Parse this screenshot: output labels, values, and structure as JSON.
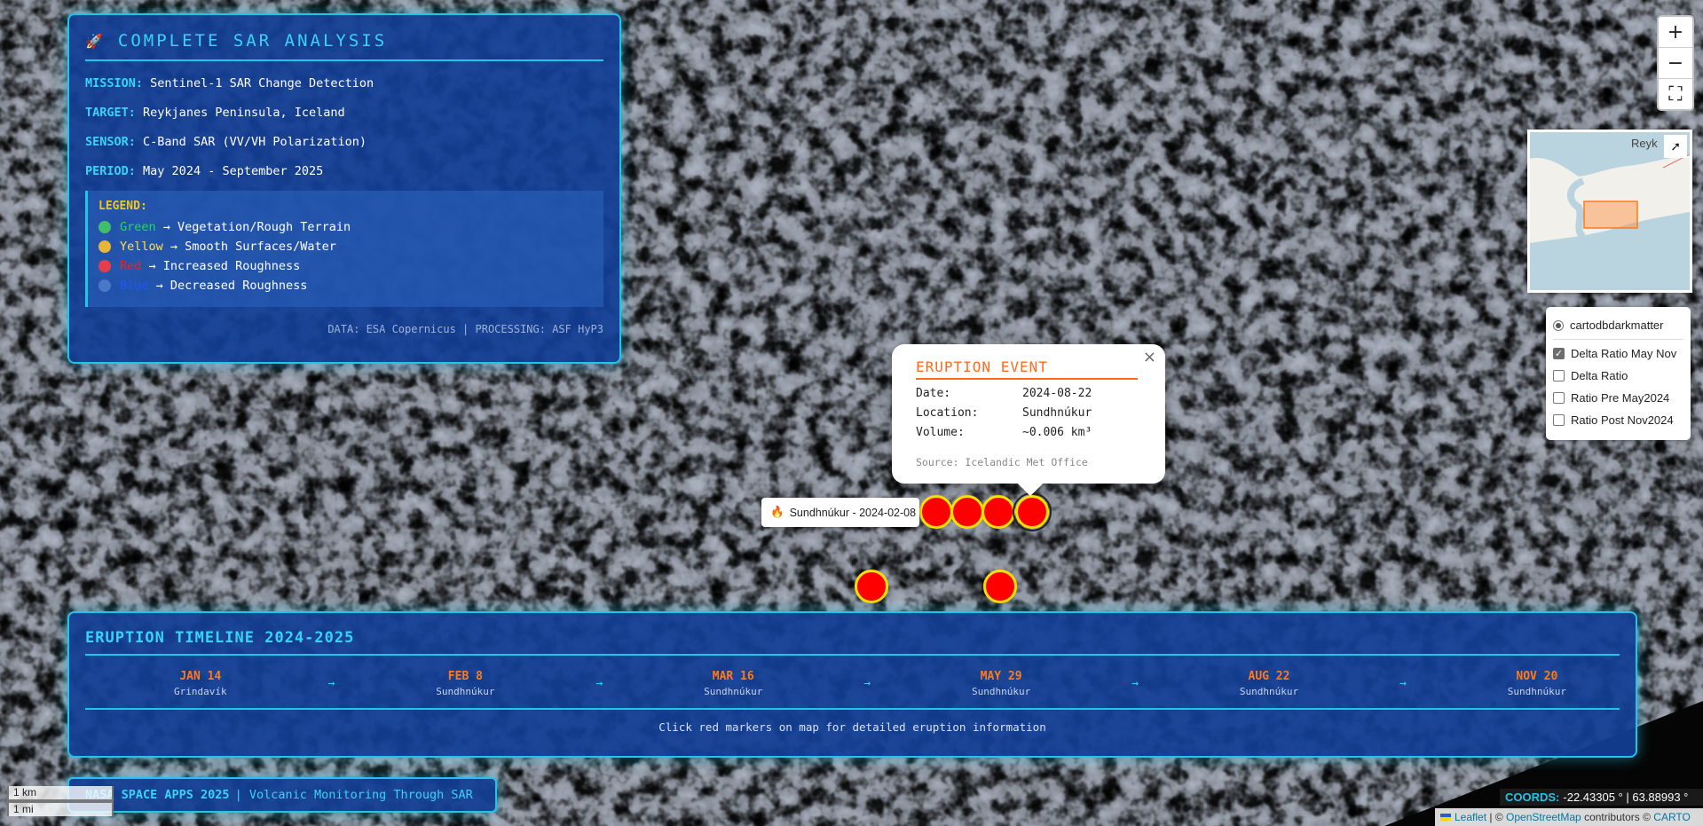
{
  "analysis": {
    "icon": "rocket-icon",
    "title": "COMPLETE SAR ANALYSIS",
    "mission_label": "MISSION:",
    "mission": "Sentinel-1 SAR Change Detection",
    "target_label": "TARGET:",
    "target": "Reykjanes Peninsula, Iceland",
    "sensor_label": "SENSOR:",
    "sensor": "C-Band SAR (VV/VH Polarization)",
    "period_label": "PERIOD:",
    "period": "May 2024 - September 2025",
    "legend": {
      "title": "LEGEND:",
      "items": [
        {
          "name": "Green",
          "desc": "→ Vegetation/Rough Terrain",
          "color": "#22dd44",
          "dot": "#3fbf6a"
        },
        {
          "name": "Yellow",
          "desc": "→ Smooth Surfaces/Water",
          "color": "#ffe14a",
          "dot": "#e8b43a"
        },
        {
          "name": "Red",
          "desc": "→ Increased Roughness",
          "color": "#ff1a1a",
          "dot": "#e53e4a"
        },
        {
          "name": "Blue",
          "desc": "→ Decreased Roughness",
          "color": "#2255ff",
          "dot": "#4a78c8"
        }
      ]
    },
    "credits": "DATA: ESA Copernicus | PROCESSING: ASF HyP3"
  },
  "timeline": {
    "title": "ERUPTION TIMELINE 2024-2025",
    "arrow": "→",
    "events": [
      {
        "date": "JAN 14",
        "place": "Grindavík"
      },
      {
        "date": "FEB 8",
        "place": "Sundhnúkur"
      },
      {
        "date": "MAR 16",
        "place": "Sundhnúkur"
      },
      {
        "date": "MAY 29",
        "place": "Sundhnúkur"
      },
      {
        "date": "AUG 22",
        "place": "Sundhnúkur"
      },
      {
        "date": "NOV 20",
        "place": "Sundhnúkur"
      }
    ],
    "footer": "Click red markers on map for detailed eruption information"
  },
  "badge": {
    "primary": "NASA SPACE APPS 2025",
    "secondary": "| Volcanic Monitoring Through SAR"
  },
  "popup": {
    "title": "ERUPTION EVENT",
    "close": "×",
    "rows": [
      {
        "label": "Date:",
        "value": "2024-08-22"
      },
      {
        "label": "Location:",
        "value": "Sundhnúkur"
      },
      {
        "label": "Volume:",
        "value": "~0.006 km³"
      }
    ],
    "source": "Source: Icelandic Met Office"
  },
  "tooltip": {
    "icon": "fire-icon",
    "text": "Sundhnúkur - 2024-02-08"
  },
  "zoom": {
    "in": "+",
    "out": "−",
    "fullscreen": "⛶"
  },
  "minimap": {
    "label": "Reyk",
    "toggle": "➚"
  },
  "layers": {
    "base": {
      "label": "cartodbdarkmatter",
      "selected": true
    },
    "overlays": [
      {
        "label": "Delta Ratio May Nov",
        "checked": true
      },
      {
        "label": "Delta Ratio",
        "checked": false
      },
      {
        "label": "Ratio Pre May2024",
        "checked": false
      },
      {
        "label": "Ratio Post Nov2024",
        "checked": false
      }
    ]
  },
  "scale": {
    "metric": "1 km",
    "imperial": "1 mi"
  },
  "coords": {
    "label": "COORDS:",
    "value": "-22.43305 ° | 63.88993 °"
  },
  "attribution": {
    "leaflet": "Leaflet",
    "sep": "| ©",
    "osm": "OpenStreetMap",
    "mid": "contributors ©",
    "carto": "CARTO"
  },
  "colors": {
    "accent": "#23c4ea",
    "panel": "#123e96",
    "event": "#ff6b1a",
    "marker": "#ff0000",
    "marker_ring": "#ffe100"
  }
}
